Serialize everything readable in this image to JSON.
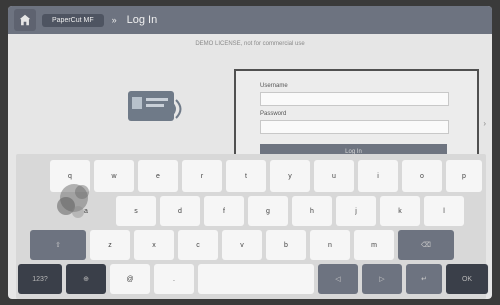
{
  "header": {
    "app_name": "PaperCut MF",
    "separator": "»",
    "title": "Log In"
  },
  "license_notice": "DEMO LICENSE, not for commercial use",
  "form": {
    "username_label": "Username",
    "password_label": "Password",
    "login_button": "Log In"
  },
  "keyboard": {
    "row1": [
      "q",
      "w",
      "e",
      "r",
      "t",
      "y",
      "u",
      "i",
      "o",
      "p"
    ],
    "row2": [
      "a",
      "s",
      "d",
      "f",
      "g",
      "h",
      "j",
      "k",
      "l"
    ],
    "row3": [
      "z",
      "x",
      "c",
      "v",
      "b",
      "n",
      "m"
    ],
    "bottom": {
      "numbers": "123?",
      "globe": "⊕",
      "at": "@",
      "dot": ".",
      "left": "◁",
      "right": "▷",
      "enter": "↵",
      "ok": "OK"
    }
  },
  "colors": {
    "topbar": "#6d7380",
    "dark_key": "#3a3f49"
  }
}
